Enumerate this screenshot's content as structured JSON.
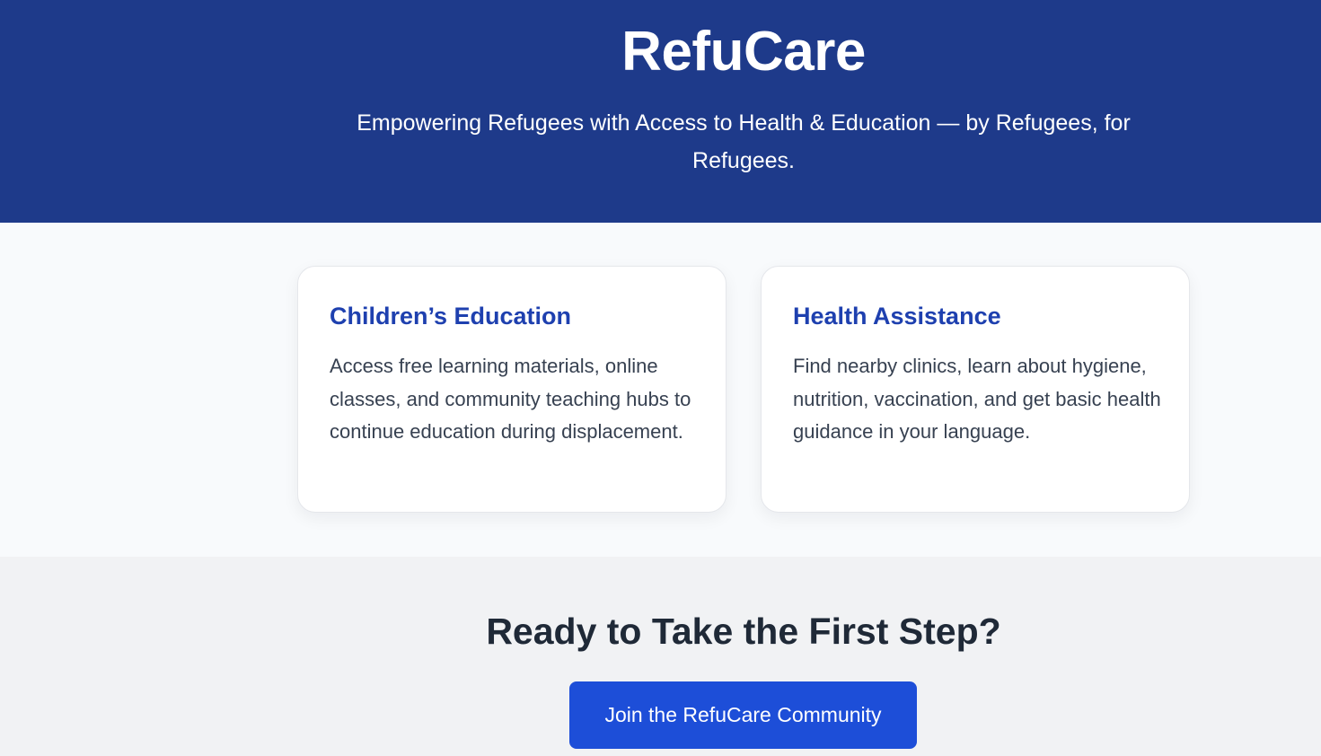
{
  "hero": {
    "title": "RefuCare",
    "subtitle": "Empowering Refugees with Access to Health & Education — by Refugees, for Refugees."
  },
  "features": [
    {
      "title": "Children’s Education",
      "description": "Access free learning materials, online classes, and community teaching hubs to continue education during displacement."
    },
    {
      "title": "Health Assistance",
      "description": "Find nearby clinics, learn about hygiene, nutrition, vaccination, and get basic health guidance in your language."
    }
  ],
  "cta": {
    "title": "Ready to Take the First Step?",
    "button_label": "Join the RefuCare Community"
  },
  "colors": {
    "hero_background": "#1e3a8a",
    "card_title": "#1e40af",
    "button_background": "#1d4ed8",
    "features_background": "#f8fafc",
    "cta_background": "#f1f2f4"
  }
}
